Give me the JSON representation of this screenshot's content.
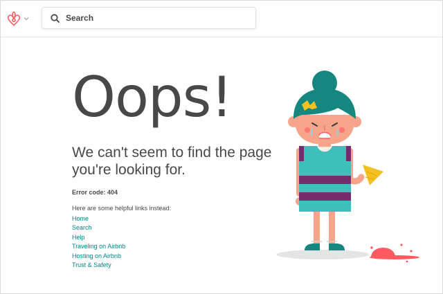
{
  "header": {
    "logo_icon": "airbnb-belo-logo",
    "logo_color": "#FF5A5F",
    "dropdown_icon": "chevron-down-icon",
    "search": {
      "icon": "search-icon",
      "placeholder": "Search",
      "value": ""
    }
  },
  "main": {
    "heading": "Oops!",
    "subtitle": "We can't seem to find the page you're looking for.",
    "error_code": "Error code: 404",
    "links_intro": "Here are some helpful links instead:",
    "links": [
      "Home",
      "Search",
      "Help",
      "Traveling on Airbnb",
      "Hosting on Airbnb",
      "Trust & Safety"
    ],
    "link_color": "#008489",
    "illustration": "girl-dropped-ice-cream"
  }
}
